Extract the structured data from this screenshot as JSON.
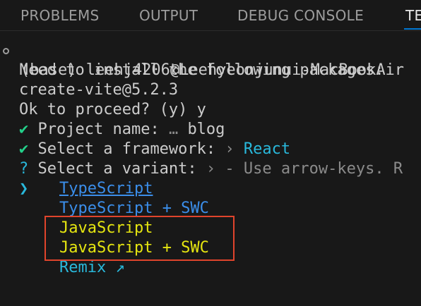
{
  "panel": {
    "tabs": [
      {
        "label": "PROBLEMS"
      },
      {
        "label": "OUTPUT"
      },
      {
        "label": "DEBUG CONSOLE"
      },
      {
        "label": "TE"
      }
    ]
  },
  "terminal": {
    "prompt_line": "(base) leehj4206@Leehyeonjunui-MacBookAir",
    "lines": [
      "Need to install the following packages:",
      "create-vite@5.2.3",
      "Ok to proceed? (y) y"
    ],
    "project_name": {
      "check": "✔",
      "label": "Project name:",
      "sep": "…",
      "value": "blog"
    },
    "framework": {
      "check": "✔",
      "label": "Select a framework:",
      "sep": "›",
      "value": "React"
    },
    "variant": {
      "mark": "?",
      "label": "Select a variant:",
      "sep": "›",
      "hint": "- Use arrow-keys. R"
    },
    "cursor": "❯",
    "options": [
      {
        "label": "TypeScript"
      },
      {
        "label": "TypeScript + SWC"
      },
      {
        "label": "JavaScript"
      },
      {
        "label": "JavaScript + SWC"
      },
      {
        "label": "Remix ↗"
      }
    ]
  },
  "colors": {
    "background": "#181818",
    "green": "#23d18b",
    "cyan": "#29b8db",
    "blue": "#3b8eea",
    "yellow": "#e5e510",
    "highlight_border": "#e0442c",
    "tab_accent": "#0078d4"
  }
}
